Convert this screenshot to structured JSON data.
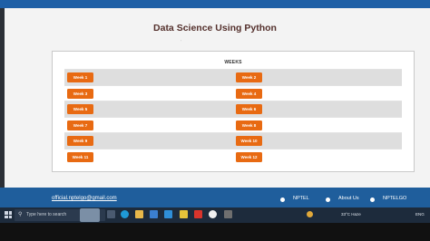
{
  "page": {
    "title": "Data Science Using Python"
  },
  "table": {
    "header": "WEEKS",
    "rows": [
      [
        "Week 1",
        "Week 2"
      ],
      [
        "Week 3",
        "Week 4"
      ],
      [
        "Week 5",
        "Week 6"
      ],
      [
        "Week 7",
        "Week 8"
      ],
      [
        "Week 9",
        "Week 10"
      ],
      [
        "Week 11",
        "Week 12"
      ]
    ]
  },
  "footer": {
    "email": "official.nptelgo@gmail.com",
    "nav": [
      "NPTEL",
      "About Us",
      "NPTELGO"
    ]
  },
  "taskbar": {
    "search_placeholder": "Type here to search",
    "weather": "33°C Haze",
    "lang": "ENG"
  },
  "colors": {
    "accent": "#e86a12",
    "footer": "#1f5e9c",
    "title": "#54302c"
  }
}
